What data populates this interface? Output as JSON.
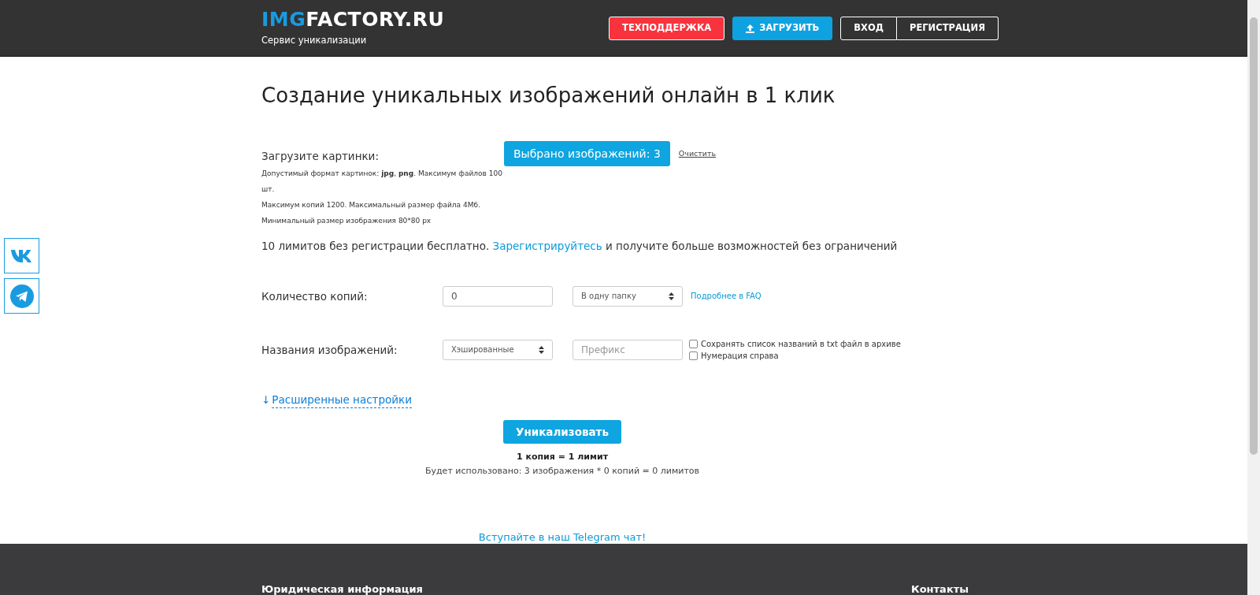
{
  "header": {
    "logo_accent": "IMG",
    "logo_rest": "FACTORY.RU",
    "subtitle": "Сервис уникализации",
    "buttons": [
      {
        "label": "ТЕХПОДДЕРЖКА",
        "kind": "danger"
      },
      {
        "label": "ЗАГРУЗИТЬ",
        "kind": "upload"
      },
      {
        "label": "ВХОД",
        "kind": "outline"
      },
      {
        "label": "РЕГИСТРАЦИЯ",
        "kind": "outline"
      }
    ]
  },
  "social": [
    {
      "kind": "vk"
    },
    {
      "kind": "telegram"
    }
  ],
  "title": "Создание уникальных изображений онлайн в 1 клик",
  "upload": {
    "label": "Загрузите картинки:",
    "notes": [
      "Допустимый формат картинок: **jpg**, **png**. Максимум файлов 100 шт.",
      "Максимум копий 1200. Максимальный размер файла 4Мб.",
      "Минимальный размер изображения 80*80 px"
    ],
    "button": "Выбрано изображений: 3",
    "clear": "Очистить"
  },
  "limits": {
    "before": "10 лимитов без регистрации бесплатно.",
    "link": "Зарегистрируйтесь",
    "after": "и получите больше возможностей без ограничений"
  },
  "copies": {
    "label": "Количество копий:",
    "value": "0",
    "select": "В одну папку",
    "link": "Подробнее в FAQ"
  },
  "names": {
    "label": "Названия изображений:",
    "select": "Хэшированные",
    "placeholder": "Префикс",
    "checkboxes": [
      {
        "label": "Сохранять список названий в txt файл в архиве",
        "checked": false
      },
      {
        "label": "Нумерация справа",
        "checked": false
      }
    ]
  },
  "advanced": {
    "arrow": "↓",
    "label": "Расширенные настройки"
  },
  "submit": "Уникализовать",
  "rate": "1 копия = 1 лимит",
  "usage": "Будет использовано: 3 изображения * 0 копий = 0 лимитов",
  "telegram_link": "Вступайте в наш Telegram чат!",
  "footer": {
    "headings": [
      "Юридическая информация",
      "Контакты"
    ]
  }
}
